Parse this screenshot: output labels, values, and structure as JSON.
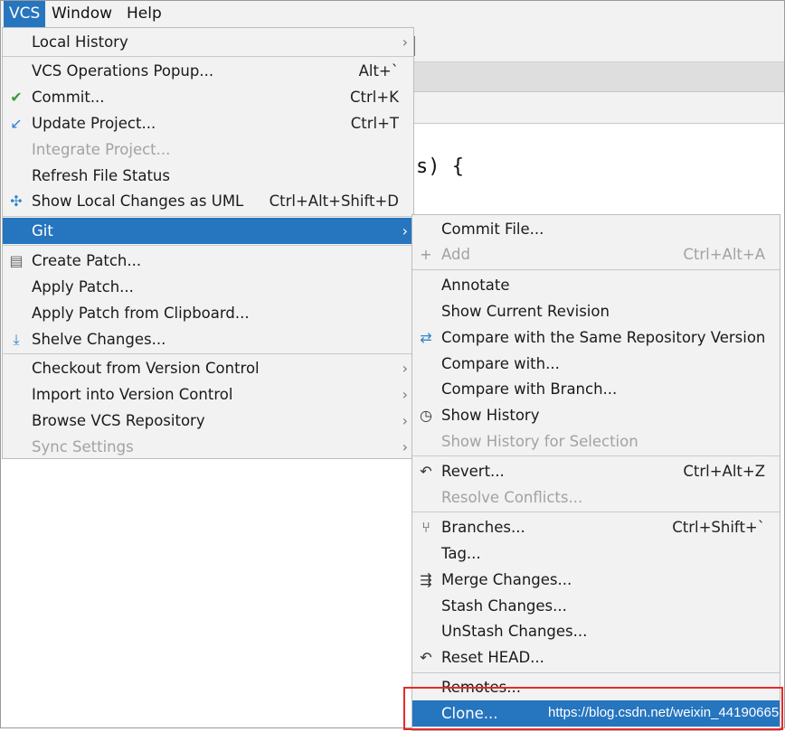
{
  "menubar": {
    "items": [
      "VCS",
      "Window",
      "Help"
    ]
  },
  "background": {
    "code": "s) {"
  },
  "vcs_menu": [
    {
      "label": "Local History",
      "shortcut": "",
      "submenu": true,
      "disabled": false,
      "icon": ""
    },
    {
      "label": "VCS Operations Popup...",
      "shortcut": "Alt+`",
      "submenu": false,
      "disabled": false,
      "icon": ""
    },
    {
      "label": "Commit...",
      "shortcut": "Ctrl+K",
      "submenu": false,
      "disabled": false,
      "icon": "check-icon"
    },
    {
      "label": "Update Project...",
      "shortcut": "Ctrl+T",
      "submenu": false,
      "disabled": false,
      "icon": "update-arrow-icon"
    },
    {
      "label": "Integrate Project...",
      "shortcut": "",
      "submenu": false,
      "disabled": true,
      "icon": ""
    },
    {
      "label": "Refresh File Status",
      "shortcut": "",
      "submenu": false,
      "disabled": false,
      "icon": ""
    },
    {
      "label": "Show Local Changes as UML",
      "shortcut": "Ctrl+Alt+Shift+D",
      "submenu": false,
      "disabled": false,
      "icon": "uml-icon"
    },
    {
      "label": "Git",
      "shortcut": "",
      "submenu": true,
      "disabled": false,
      "icon": "",
      "selected": true
    },
    {
      "label": "Create Patch...",
      "shortcut": "",
      "submenu": false,
      "disabled": false,
      "icon": "patch-icon"
    },
    {
      "label": "Apply Patch...",
      "shortcut": "",
      "submenu": false,
      "disabled": false,
      "icon": ""
    },
    {
      "label": "Apply Patch from Clipboard...",
      "shortcut": "",
      "submenu": false,
      "disabled": false,
      "icon": ""
    },
    {
      "label": "Shelve Changes...",
      "shortcut": "",
      "submenu": false,
      "disabled": false,
      "icon": "shelve-icon"
    },
    {
      "label": "Checkout from Version Control",
      "shortcut": "",
      "submenu": true,
      "disabled": false,
      "icon": ""
    },
    {
      "label": "Import into Version Control",
      "shortcut": "",
      "submenu": true,
      "disabled": false,
      "icon": ""
    },
    {
      "label": "Browse VCS Repository",
      "shortcut": "",
      "submenu": true,
      "disabled": false,
      "icon": ""
    },
    {
      "label": "Sync Settings",
      "shortcut": "",
      "submenu": true,
      "disabled": true,
      "icon": ""
    }
  ],
  "git_menu": [
    {
      "label": "Commit File...",
      "shortcut": "",
      "disabled": false,
      "icon": ""
    },
    {
      "label": "Add",
      "shortcut": "Ctrl+Alt+A",
      "disabled": true,
      "icon": "plus-icon"
    },
    {
      "label": "Annotate",
      "shortcut": "",
      "disabled": false,
      "icon": ""
    },
    {
      "label": "Show Current Revision",
      "shortcut": "",
      "disabled": false,
      "icon": ""
    },
    {
      "label": "Compare with the Same Repository Version",
      "shortcut": "",
      "disabled": false,
      "icon": "compare-icon"
    },
    {
      "label": "Compare with...",
      "shortcut": "",
      "disabled": false,
      "icon": ""
    },
    {
      "label": "Compare with Branch...",
      "shortcut": "",
      "disabled": false,
      "icon": ""
    },
    {
      "label": "Show History",
      "shortcut": "",
      "disabled": false,
      "icon": "clock-icon"
    },
    {
      "label": "Show History for Selection",
      "shortcut": "",
      "disabled": true,
      "icon": ""
    },
    {
      "label": "Revert...",
      "shortcut": "Ctrl+Alt+Z",
      "disabled": false,
      "icon": "revert-icon"
    },
    {
      "label": "Resolve Conflicts...",
      "shortcut": "",
      "disabled": true,
      "icon": ""
    },
    {
      "label": "Branches...",
      "shortcut": "Ctrl+Shift+`",
      "disabled": false,
      "icon": "branch-icon"
    },
    {
      "label": "Tag...",
      "shortcut": "",
      "disabled": false,
      "icon": ""
    },
    {
      "label": "Merge Changes...",
      "shortcut": "",
      "disabled": false,
      "icon": "merge-icon"
    },
    {
      "label": "Stash Changes...",
      "shortcut": "",
      "disabled": false,
      "icon": ""
    },
    {
      "label": "UnStash Changes...",
      "shortcut": "",
      "disabled": false,
      "icon": ""
    },
    {
      "label": "Reset HEAD...",
      "shortcut": "",
      "disabled": false,
      "icon": "reset-icon"
    },
    {
      "label": "Remotes...",
      "shortcut": "",
      "disabled": false,
      "icon": ""
    },
    {
      "label": "Clone...",
      "shortcut": "",
      "disabled": false,
      "icon": "",
      "selected": true
    }
  ],
  "watermark": "https://blog.csdn.net/weixin_44190665",
  "colors": {
    "selection": "#2675bf",
    "highlight_box": "#e8282a",
    "menu_bg": "#f2f2f2"
  }
}
